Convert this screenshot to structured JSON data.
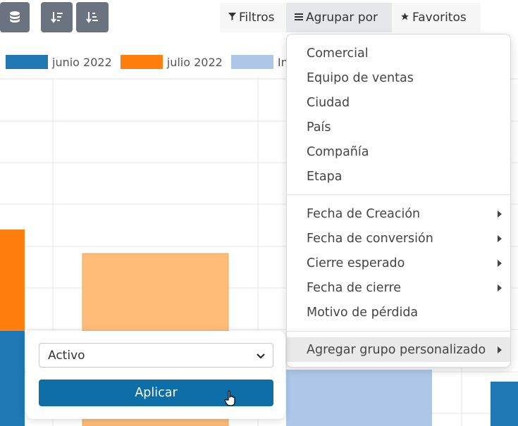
{
  "toolbar": {
    "icons": [
      "database-icon",
      "sort-descending-icon",
      "sort-ascending-icon"
    ],
    "filters_label": "Filtros",
    "group_by_label": "Agrupar por",
    "favorites_label": "Favoritos"
  },
  "chart_data": {
    "type": "bar",
    "series": [
      {
        "name": "junio 2022",
        "color": "#1f77b4"
      },
      {
        "name": "julio 2022",
        "color": "#ff7f0e"
      },
      {
        "name": "Inde",
        "color": "#aec7e8"
      }
    ],
    "grid": true
  },
  "group_by_menu": {
    "section1": [
      "Comercial",
      "Equipo de ventas",
      "Ciudad",
      "País",
      "Compañía",
      "Etapa"
    ],
    "section2": [
      {
        "label": "Fecha de Creación",
        "submenu": true
      },
      {
        "label": "Fecha de conversión",
        "submenu": true
      },
      {
        "label": "Cierre esperado",
        "submenu": true
      },
      {
        "label": "Fecha de cierre",
        "submenu": true
      },
      {
        "label": "Motivo de pérdida",
        "submenu": false
      }
    ],
    "custom_group_label": "Agregar grupo personalizado"
  },
  "custom_group_panel": {
    "selected_field": "Activo",
    "apply_label": "Aplicar"
  },
  "colors": {
    "toolbar_button": "#6b7280",
    "apply_button": "#0e6fa8",
    "series_blue": "#1f77b4",
    "series_orange": "#ff7f0e",
    "series_light_blue": "#aec7e8",
    "series_light_orange": "#ffbb78"
  }
}
